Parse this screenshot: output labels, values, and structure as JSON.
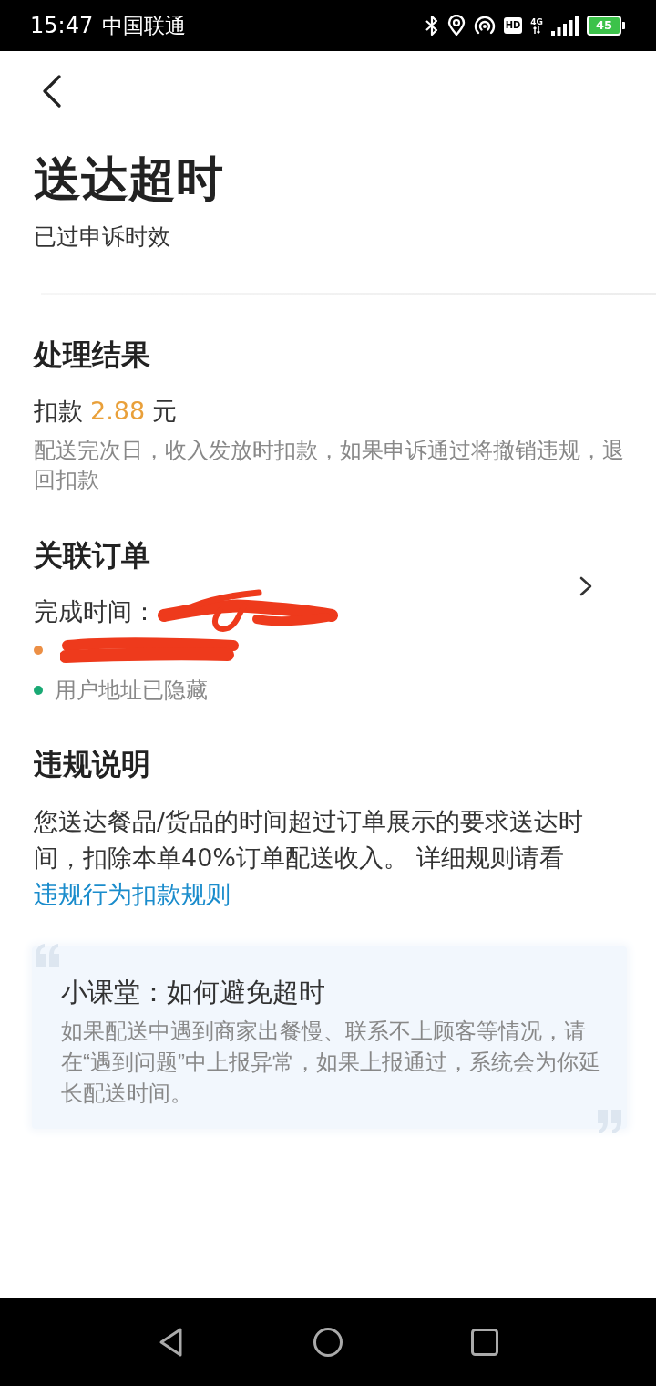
{
  "status_bar": {
    "time": "15:47",
    "carrier": "中国联通",
    "hd_badge": "HD",
    "network": "4G",
    "battery": "45"
  },
  "header": {
    "title": "送达超时",
    "subtitle": "已过申诉时效"
  },
  "result": {
    "heading": "处理结果",
    "deduction": {
      "label": "扣款",
      "amount": "2.88",
      "unit": "元"
    },
    "note": "配送完次日，收入发放时扣款，如果申诉通过将撤销违规，退回扣款"
  },
  "order": {
    "heading": "关联订单",
    "completion": {
      "label": "完成时间：",
      "redacted": true
    },
    "points": [
      {
        "color": "#ec8f45",
        "redacted": true
      },
      {
        "color": "#19a974",
        "redacted": false,
        "text": "用户地址已隐藏"
      }
    ]
  },
  "violation": {
    "heading": "违规说明",
    "text": "您送达餐品/货品的时间超过订单展示的要求送达时间，扣除本单40%订单配送收入。 详细规则请看 ",
    "link": "违规行为扣款规则"
  },
  "tip": {
    "title": "小课堂：如何避免超时",
    "text": "如果配送中遇到商家出餐慢、联系不上顾客等情况，请在“遇到问题”中上报异常，如果上报通过，系统会为你延长配送时间。"
  }
}
